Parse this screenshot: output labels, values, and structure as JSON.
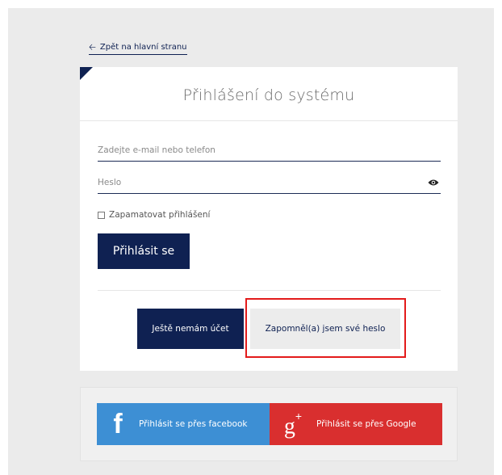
{
  "back_link": {
    "label": "Zpět na hlavní stranu",
    "icon": "arrow-left-icon"
  },
  "login_card": {
    "title": "Přihlášení do systému",
    "email": {
      "placeholder": "Zadejte e-mail nebo telefon",
      "value": ""
    },
    "password": {
      "placeholder": "Heslo",
      "value": "",
      "icon": "eye-icon"
    },
    "remember_label": "Zapamatovat přihlášení",
    "remember_checked": false,
    "login_button": "Přihlásit se",
    "register_button": "Ještě nemám účet",
    "forgot_button": "Zapomněl(a) jsem své heslo"
  },
  "social": {
    "facebook": {
      "label": "Přihlásit se přes facebook",
      "logo": "f",
      "color": "#3d8fd4"
    },
    "google": {
      "label": "Přihlásit se přes Google",
      "logo": "g",
      "logo_sup": "+",
      "color": "#d92f2f"
    }
  },
  "colors": {
    "primary": "#0f2152",
    "highlight": "#e31b1b",
    "background": "#ebebeb"
  }
}
